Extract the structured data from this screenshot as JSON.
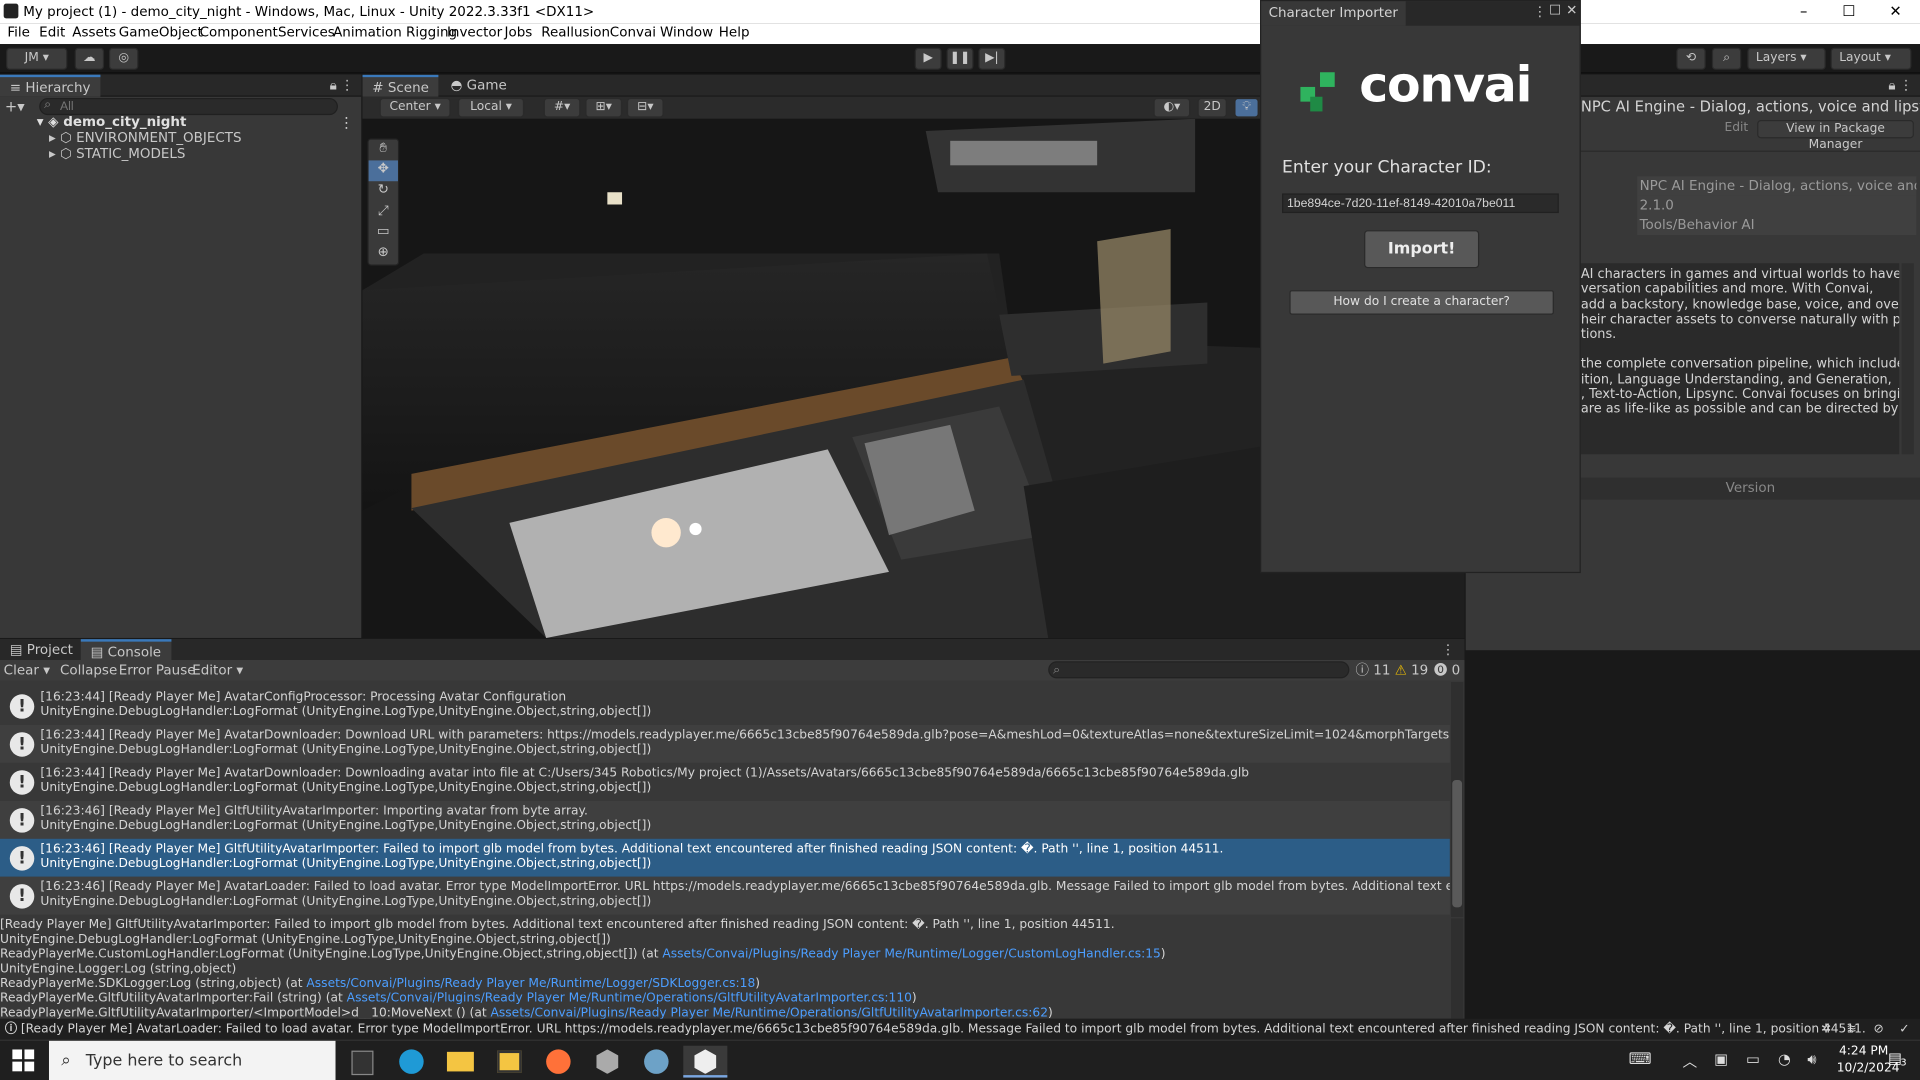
{
  "window": {
    "title": "My project (1) - demo_city_night - Windows, Mac, Linux - Unity 2022.3.33f1 <DX11>",
    "min": "–",
    "max": "☐",
    "close": "✕"
  },
  "menu": [
    "File",
    "Edit",
    "Assets",
    "GameObject",
    "Component",
    "Services",
    "Animation Rigging",
    "Invector",
    "Jobs",
    "Reallusion",
    "Convai",
    "Window",
    "Help"
  ],
  "toolbar": {
    "account": "JM ▾",
    "layers": "Layers",
    "layout": "Layout",
    "play": "▶",
    "pause": "❚❚",
    "step": "▶|"
  },
  "hierarchy": {
    "title": "Hierarchy",
    "search_placeholder": "All",
    "root": "demo_city_night",
    "children": [
      "ENVIRONMENT_OBJECTS",
      "STATIC_MODELS"
    ]
  },
  "scene": {
    "tabs": [
      "Scene",
      "Game"
    ],
    "pivot": "Center",
    "space": "Local",
    "mode2d": "2D"
  },
  "character_importer": {
    "title": "Character Importer",
    "logo": "convai",
    "prompt": "Enter your Character ID:",
    "character_id": "1be894ce-7d20-11ef-8149-42010a7be011",
    "import_label": "Import!",
    "help_label": "How do I create a character?"
  },
  "inspector": {
    "header": "NPC AI Engine - Dialog, actions, voice and lipsync - Cor",
    "edit": "Edit",
    "view_pkg": "View in Package Manager",
    "fields": [
      "NPC AI Engine - Dialog, actions, voice and lipsyn",
      "2.1.0",
      "Tools/Behavior AI"
    ],
    "desc1": [
      "AI characters in games and virtual worlds to have",
      "versation capabilities and more. With Convai,",
      "add a backstory, knowledge base, voice, and overall",
      "heir character assets to converse naturally with players",
      "tions."
    ],
    "desc2": [
      "the complete conversation pipeline, which includes",
      "ition, Language Understanding, and Generation,",
      ", Text-to-Action, Lipsync. Convai focuses on bringing",
      "are as life-like as possible and can be directed by any"
    ],
    "version_label": "Version"
  },
  "console": {
    "tabs": [
      "Project",
      "Console"
    ],
    "clear": "Clear",
    "collapse": "Collapse",
    "error_pause": "Error Pause",
    "editor": "Editor",
    "counts": {
      "info": "11",
      "warn": "19",
      "error": "0"
    },
    "logs": [
      {
        "l1": "[16:23:44] [Ready Player Me] AvatarConfigProcessor: Processing Avatar Configuration",
        "l2": "UnityEngine.DebugLogHandler:LogFormat (UnityEngine.LogType,UnityEngine.Object,string,object[])"
      },
      {
        "l1": "[16:23:44] [Ready Player Me] AvatarDownloader: Download URL with parameters: https://models.readyplayer.me/6665c13cbe85f90764e589da.glb?pose=A&meshLod=0&textureAtlas=none&textureSizeLimit=1024&morphTargets=Oculus Visemes,eyeBl",
        "l2": "UnityEngine.DebugLogHandler:LogFormat (UnityEngine.LogType,UnityEngine.Object,string,object[])"
      },
      {
        "l1": "[16:23:44] [Ready Player Me] AvatarDownloader: Downloading avatar into file at C:/Users/345 Robotics/My project (1)/Assets/Avatars/6665c13cbe85f90764e589da/6665c13cbe85f90764e589da.glb",
        "l2": "UnityEngine.DebugLogHandler:LogFormat (UnityEngine.LogType,UnityEngine.Object,string,object[])"
      },
      {
        "l1": "[16:23:46] [Ready Player Me] GltfUtilityAvatarImporter: Importing avatar from byte array.",
        "l2": "UnityEngine.DebugLogHandler:LogFormat (UnityEngine.LogType,UnityEngine.Object,string,object[])"
      },
      {
        "l1": "[16:23:46] [Ready Player Me] GltfUtilityAvatarImporter: Failed to import glb model from bytes. Additional text encountered after finished reading JSON content: �. Path '', line 1, position 44511.",
        "l2": "UnityEngine.DebugLogHandler:LogFormat (UnityEngine.LogType,UnityEngine.Object,string,object[])"
      },
      {
        "l1": "[16:23:46] [Ready Player Me] AvatarLoader: Failed to load avatar. Error type ModelImportError. URL https://models.readyplayer.me/6665c13cbe85f90764e589da.glb. Message Failed to import glb model from bytes. Additional text encountered after finishe",
        "l2": "UnityEngine.DebugLogHandler:LogFormat (UnityEngine.LogType,UnityEngine.Object,string,object[])"
      }
    ],
    "detail": {
      "d1": "[Ready Player Me] GltfUtilityAvatarImporter: Failed to import glb model from bytes. Additional text encountered after finished reading JSON content: �. Path '', line 1, position 44511.",
      "d2": "UnityEngine.DebugLogHandler:LogFormat (UnityEngine.LogType,UnityEngine.Object,string,object[])",
      "d3a": "ReadyPlayerMe.CustomLogHandler:LogFormat (UnityEngine.LogType,UnityEngine.Object,string,object[]) (at ",
      "d3b": "Assets/Convai/Plugins/Ready Player Me/Runtime/Logger/CustomLogHandler.cs:15",
      "d3c": ")",
      "d4": "UnityEngine.Logger:Log (string,object)",
      "d5a": "ReadyPlayerMe.SDKLogger:Log (string,object) (at ",
      "d5b": "Assets/Convai/Plugins/Ready Player Me/Runtime/Logger/SDKLogger.cs:18",
      "d5c": ")",
      "d6a": "ReadyPlayerMe.GltfUtilityAvatarImporter:Fail (string) (at ",
      "d6b": "Assets/Convai/Plugins/Ready Player Me/Runtime/Operations/GltfUtilityAvatarImporter.cs:110",
      "d6c": ")",
      "d7a": "ReadyPlayerMe.GltfUtilityAvatarImporter/<ImportModel>d__10:MoveNext () (at ",
      "d7b": "Assets/Convai/Plugins/Ready Player Me/Runtime/Operations/GltfUtilityAvatarImporter.cs:62",
      "d7c": ")"
    }
  },
  "status_message": "[Ready Player Me] AvatarLoader: Failed to load avatar. Error type ModelImportError. URL https://models.readyplayer.me/6665c13cbe85f90764e589da.glb. Message Failed to import glb model from bytes. Additional text encountered after finished reading JSON content: �. Path '', line 1, position 44511.",
  "taskbar": {
    "search_placeholder": "Type here to search",
    "time": "4:24 PM",
    "date": "10/2/2024",
    "notif": "3"
  }
}
